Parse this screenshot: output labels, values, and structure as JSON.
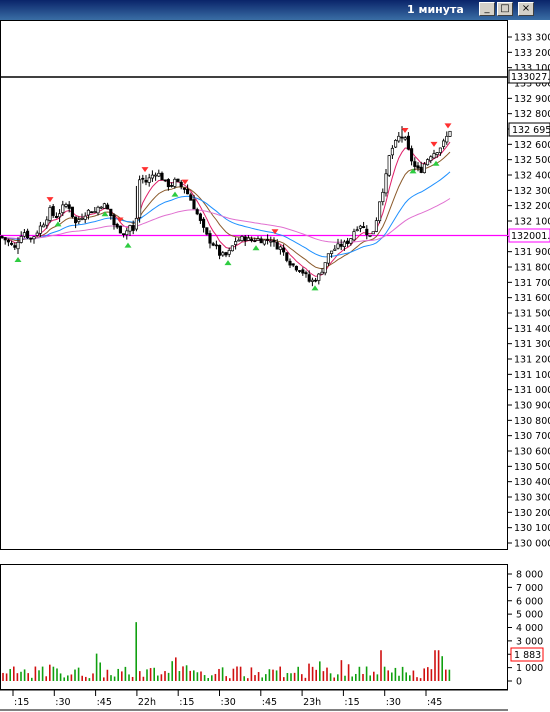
{
  "window": {
    "title": "1 минута",
    "buttons": [
      "_",
      "□",
      "×"
    ]
  },
  "price_panel": {
    "y_ticks": [
      "133 300",
      "133 200",
      "133 100",
      "133 000",
      "132 900",
      "132 800",
      "132 700",
      "132 600",
      "132 500",
      "132 400",
      "132 300",
      "132 200",
      "132 100",
      "132 000",
      "131 900",
      "131 800",
      "131 700",
      "131 600",
      "131 500",
      "131 400",
      "131 300",
      "131 200",
      "131 100",
      "131 000",
      "130 900",
      "130 800",
      "130 700",
      "130 600",
      "130 500",
      "130 400",
      "130 300",
      "130 200",
      "130 100",
      "130 000"
    ],
    "badges": {
      "black_line": "133027.0",
      "last_price": "132 695",
      "magenta_line": "132001.0"
    }
  },
  "volume_panel": {
    "y_ticks": [
      "8 000",
      "7 000",
      "6 000",
      "5 000",
      "4 000",
      "3 000",
      "2 000",
      "1 000",
      "0"
    ],
    "last_volume": "1 883"
  },
  "time_axis": {
    "labels": [
      ":15",
      ":30",
      ":45",
      "22h",
      ":15",
      ":30",
      ":45",
      "23h",
      ":15",
      ":30",
      ":45"
    ]
  },
  "colors": {
    "bull": "#10a010",
    "bear": "#d01010",
    "ma_fast": "#e0206a",
    "ma_mid": "#8b5a2b",
    "ma_slow": "#1e90ff",
    "ma_long": "#e070d0",
    "level_magenta": "#ff00ff",
    "level_black": "#000000",
    "buy_marker": "#2ecc40",
    "sell_marker": "#ff3030"
  },
  "chart_data": [
    {
      "type": "candlestick",
      "x_range": [
        "21h15",
        "22h45"
      ],
      "ylim": [
        130000,
        133300
      ],
      "levels": [
        133027.0,
        132001.0
      ],
      "last_price": 132695,
      "close_path": [
        [
          0,
          132000
        ],
        [
          5,
          131980
        ],
        [
          10,
          131950
        ],
        [
          15,
          131920
        ],
        [
          20,
          132010
        ],
        [
          25,
          132030
        ],
        [
          30,
          131980
        ],
        [
          35,
          132010
        ],
        [
          40,
          132060
        ],
        [
          45,
          132100
        ],
        [
          50,
          132170
        ],
        [
          55,
          132120
        ],
        [
          60,
          132160
        ],
        [
          65,
          132210
        ],
        [
          70,
          132190
        ],
        [
          75,
          132080
        ],
        [
          80,
          132120
        ],
        [
          85,
          132150
        ],
        [
          90,
          132170
        ],
        [
          95,
          132160
        ],
        [
          100,
          132210
        ],
        [
          105,
          132200
        ],
        [
          110,
          132150
        ],
        [
          115,
          132060
        ],
        [
          120,
          132040
        ],
        [
          125,
          132020
        ],
        [
          130,
          132070
        ],
        [
          135,
          132010
        ],
        [
          140,
          132400
        ],
        [
          145,
          132350
        ],
        [
          150,
          132380
        ],
        [
          155,
          132420
        ],
        [
          160,
          132400
        ],
        [
          165,
          132350
        ],
        [
          170,
          132330
        ],
        [
          175,
          132360
        ],
        [
          180,
          132330
        ],
        [
          185,
          132310
        ],
        [
          190,
          132250
        ],
        [
          195,
          132180
        ],
        [
          200,
          132100
        ],
        [
          205,
          132020
        ],
        [
          210,
          131970
        ],
        [
          215,
          131940
        ],
        [
          220,
          131880
        ],
        [
          225,
          131870
        ],
        [
          230,
          131900
        ],
        [
          235,
          131970
        ],
        [
          240,
          131980
        ],
        [
          245,
          131990
        ],
        [
          250,
          131970
        ],
        [
          255,
          131980
        ],
        [
          260,
          131980
        ],
        [
          265,
          131970
        ],
        [
          270,
          131990
        ],
        [
          275,
          131940
        ],
        [
          280,
          131930
        ],
        [
          285,
          131880
        ],
        [
          290,
          131830
        ],
        [
          295,
          131800
        ],
        [
          300,
          131790
        ],
        [
          305,
          131750
        ],
        [
          310,
          131700
        ],
        [
          315,
          131720
        ],
        [
          320,
          131750
        ],
        [
          325,
          131830
        ],
        [
          330,
          131900
        ],
        [
          335,
          131920
        ],
        [
          340,
          131940
        ],
        [
          345,
          131950
        ],
        [
          350,
          131980
        ],
        [
          355,
          132050
        ],
        [
          360,
          132080
        ],
        [
          365,
          132040
        ],
        [
          370,
          132000
        ],
        [
          375,
          132060
        ],
        [
          380,
          132250
        ],
        [
          385,
          132350
        ],
        [
          390,
          132550
        ],
        [
          395,
          132600
        ],
        [
          400,
          132660
        ],
        [
          405,
          132630
        ],
        [
          410,
          132520
        ],
        [
          415,
          132450
        ],
        [
          420,
          132420
        ],
        [
          425,
          132480
        ],
        [
          430,
          132530
        ],
        [
          435,
          132550
        ],
        [
          440,
          132580
        ],
        [
          445,
          132620
        ],
        [
          450,
          132695
        ]
      ]
    },
    {
      "type": "bar",
      "title": "Volume",
      "ylim": [
        0,
        8000
      ],
      "last_value": 1883
    }
  ]
}
